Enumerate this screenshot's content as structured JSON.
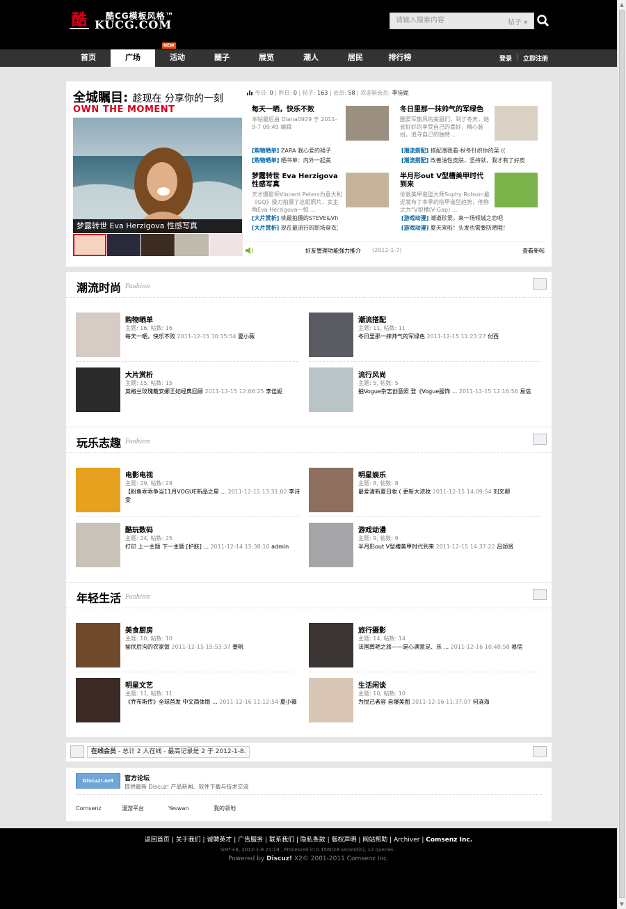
{
  "header": {
    "logo_cn": "酷CG模板风格™",
    "logo_en": "KUCG.COM",
    "logo_mark": "酷",
    "search_placeholder": "请输入搜索内容",
    "search_type": "帖子 ▾"
  },
  "nav": {
    "items": [
      "首页",
      "广场",
      "活动",
      "圈子",
      "展览",
      "潮人",
      "居民",
      "排行榜"
    ],
    "active": "广场",
    "new_badge": "NEW",
    "login": "登录",
    "sep": "|",
    "register": "立即注册"
  },
  "hero": {
    "headline_bold": "全城瞩目:",
    "headline_rest": "趁现在 分享你的一刻",
    "headline_en": "OWN THE MOMENT",
    "caption": "梦露转世 Eva Herzigova 性感写真",
    "stats": {
      "today_label": "今日:",
      "today": "0",
      "yesterday_label": "昨日:",
      "yesterday": "0",
      "posts_label": "帖子:",
      "posts": "163",
      "members_label": "会员:",
      "members": "58",
      "welcome_label": "欢迎新会员:",
      "newest": "李佳妮"
    },
    "articles": [
      {
        "title": "每天一晒，快乐不败",
        "desc": "本帖最后由 Diana0929 于 2011-9-7 09:49 编辑"
      },
      {
        "title": "冬日里那一抹帅气的军绿色",
        "desc": "酷爱军旅风的美眉们，到了冬天，她会好好的享受自己的喜好，精心装扮，追寻自己的独特 ..."
      },
      {
        "title": "梦露转世 Eva Herzigova 性感写真",
        "desc": "天才摄影师Vincent Peters为意大利《GQ》操刀拍摄了这组照片，女主角Eva Herzigova一如 ..."
      },
      {
        "title": "半月形out V型槽美甲时代到来",
        "desc": "伦敦美甲造型大师Sophy Robson最近发布了本季的指甲造型趋势，他称之为“V型槽(V-Gap) ..."
      }
    ],
    "links": [
      {
        "tag": "[购物晒单]",
        "text": "ZARA 我心爱的裙子"
      },
      {
        "tag": "[购物晒单]",
        "text": "晒书单：内外一起美"
      },
      {
        "tag": "[潮流搭配]",
        "text": "搭配潮我看-秋冬针织你的菜 (("
      },
      {
        "tag": "[潮流搭配]",
        "text": "改善油性皮肤，坚持就，我才有了好皮"
      },
      {
        "tag": "[大片赏析]",
        "text": "桃最拍摄的STEVE&VIVIAN2011复古风"
      },
      {
        "tag": "[大片赏析]",
        "text": "现在最流行的职场穿衣方法"
      },
      {
        "tag": "[游戏动漫]",
        "text": "潮道珍爱，来一场倾城之恋吧"
      },
      {
        "tag": "[游戏动漫]",
        "text": "夏天来啦！头发也需要防晒哦！"
      }
    ],
    "notice": "好友管理功能强力推介",
    "notice_date": "(2012-1-7)",
    "view_new": "查看新帖"
  },
  "sections": [
    {
      "title": "潮流时尚",
      "subtitle": "Fashion",
      "forums": [
        {
          "name": "购物晒单",
          "counts": "主题: 16, 帖数: 16",
          "last": "每天一晒，快乐不败",
          "meta": "2011-12-15 10:15:54",
          "user": "夏小薇"
        },
        {
          "name": "潮流搭配",
          "counts": "主题: 11, 帖数: 11",
          "last": "冬日里那一抹帅气的军绿色",
          "meta": "2011-12-15 11:23:27",
          "user": "付西"
        },
        {
          "name": "大片赏析",
          "counts": "主题: 15, 帖数: 15",
          "last": "英格兰玫瑰戴安娜王妃经典回顾",
          "meta": "2011-12-15 12:06:25",
          "user": "李佳妮"
        },
        {
          "name": "流行风尚",
          "counts": "主题: 5, 帖数: 5",
          "last": "拍Vogue杂志创意照 登《Vogue服饰 ...",
          "meta": "2011-12-15 12:16:56",
          "user": "易信"
        }
      ]
    },
    {
      "title": "玩乐志趣",
      "subtitle": "Fashion",
      "forums": [
        {
          "name": "电影电视",
          "counts": "主题: 29, 帖数: 29",
          "last": "【粉鱼乖乖争当11月VOGUE新品之星 ...",
          "meta": "2011-12-15 13:31:02",
          "user": "李诗雯"
        },
        {
          "name": "明星娱乐",
          "counts": "主题: 8, 帖数: 8",
          "last": "最爱清新夏日妆 ( 更新大浓妆",
          "meta": "2011-12-15 14:09:54",
          "user": "刘文卿"
        },
        {
          "name": "酷玩数码",
          "counts": "主题: 24, 帖数: 25",
          "last": "打印 上一主题 下一主题 [护肤] ...",
          "meta": "2011-12-14 15:38:10",
          "user": "admin"
        },
        {
          "name": "游戏动漫",
          "counts": "主题: 9, 帖数: 9",
          "last": "半月形out V型槽美甲时代到来",
          "meta": "2011-12-15 14:37:22",
          "user": "吕颂贤"
        }
      ]
    },
    {
      "title": "年轻生活",
      "subtitle": "Fashion",
      "forums": [
        {
          "name": "美食厨房",
          "counts": "主题: 10, 帖数: 10",
          "last": "揄伏后沟的农家饭",
          "meta": "2011-12-15 15:53:37",
          "user": "姜帆"
        },
        {
          "name": "旅行摄影",
          "counts": "主题: 14, 帖数: 14",
          "last": "法国葬艳之旅——是心满意足、乐 ...",
          "meta": "2011-12-16 10:48:58",
          "user": "易信"
        },
        {
          "name": "明星文艺",
          "counts": "主题: 11, 帖数: 11",
          "last": "《乔布斯传》全球首发 中文简体版 ...",
          "meta": "2011-12-16 11:12:54",
          "user": "夏小薇"
        },
        {
          "name": "生活闲谈",
          "counts": "主题: 10, 帖数: 10",
          "last": "为悦己者容 自爆美图",
          "meta": "2011-12-16 11:37:07",
          "user": "何涟海"
        }
      ]
    }
  ],
  "online": {
    "label": "在线会员",
    "text": "- 总计 2 人在线 - 最高记录是 2 于 2012-1-8."
  },
  "friends": {
    "title": "官方论坛",
    "desc": "提供最新 Discuz! 产品新闻、软件下载与技术交流",
    "badge": "Discuz!.net",
    "links": [
      "Comsenz",
      "漫游平台",
      "Yeswan",
      "我的领地"
    ]
  },
  "footer": {
    "links": [
      "返回首页",
      "关于我们",
      "诚聘英才",
      "广告服务",
      "联系我们",
      "隐私条款",
      "版权声明",
      "网站帮助",
      "Archiver",
      "Comsenz Inc."
    ],
    "time": "GMT+8, 2012-1-8 21:19 , Processed in 0.156028 second(s), 12 queries .",
    "powered_prefix": "Powered by ",
    "powered_brand": "Discuz!",
    "powered_rest": " X2© 2001-2011 Comsenz Inc."
  }
}
